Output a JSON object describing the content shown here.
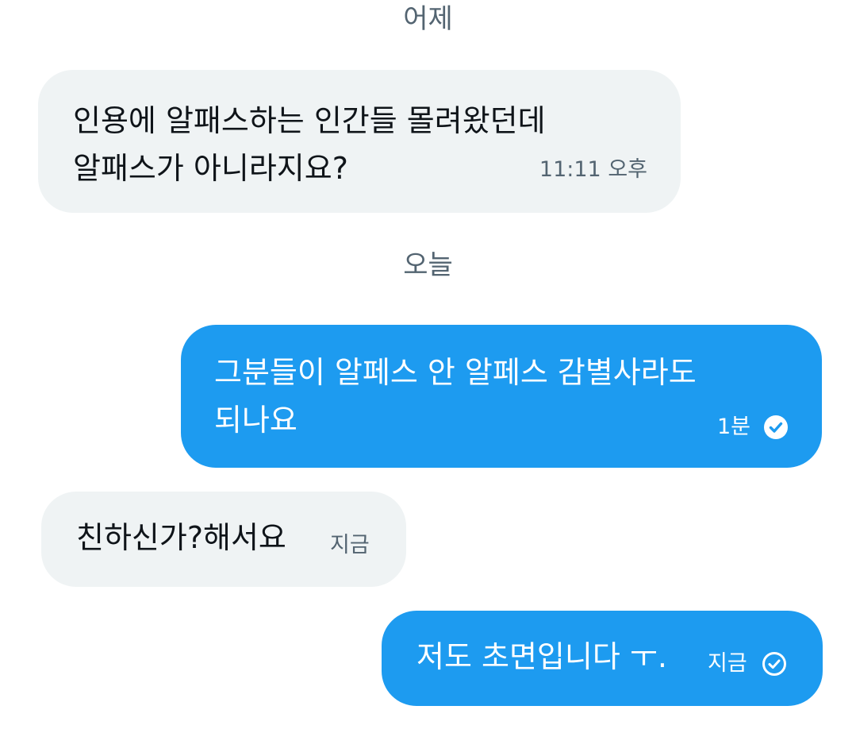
{
  "conversation": {
    "date_yesterday": "어제",
    "date_today": "오늘",
    "messages": [
      {
        "direction": "incoming",
        "lines": [
          "인용에 알패스하는 인간들 몰려왔던데",
          "알패스가 아니라지요?"
        ],
        "time": "11:11 오후"
      },
      {
        "direction": "outgoing",
        "lines": [
          "그분들이 알페스 안 알페스 감별사라도",
          "되나요"
        ],
        "time": "1분",
        "status_icon": "check-circle-filled-icon"
      },
      {
        "direction": "incoming",
        "lines": [
          "친하신가?해서요"
        ],
        "time": "지금"
      },
      {
        "direction": "outgoing",
        "lines": [
          "저도 초면입니다 ㅜ."
        ],
        "time": "지금",
        "status_icon": "check-circle-outline-icon"
      }
    ]
  },
  "colors": {
    "incoming_bubble": "#eff3f4",
    "outgoing_bubble": "#1d9bf0",
    "date_text": "#536471"
  }
}
